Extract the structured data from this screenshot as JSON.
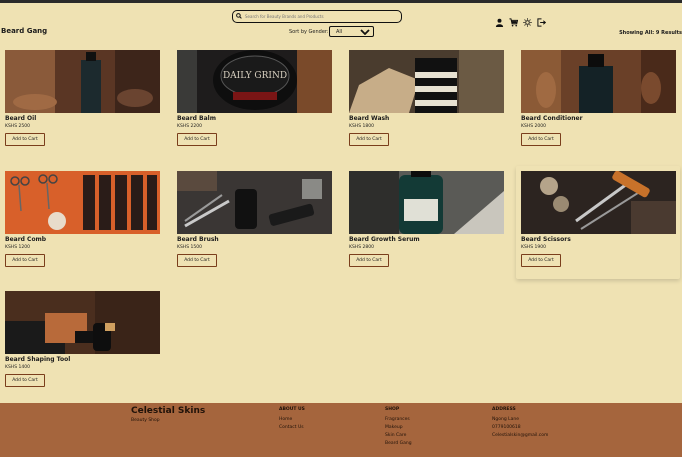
{
  "header": {
    "search_placeholder": "Search for Beauty Brands and Products",
    "icons": [
      "user-icon",
      "cart-icon",
      "theme-icon",
      "logout-icon"
    ]
  },
  "page": {
    "title": "Beard Gang",
    "sort_label": "Sort by Gender:",
    "sort_value": "All",
    "showing": "Showing All: 9 Results"
  },
  "products": [
    {
      "name": "Beard Oil",
      "price": "KSHS 2500",
      "button": "Add to Cart"
    },
    {
      "name": "Beard Balm",
      "price": "KSHS 2200",
      "button": "Add to Cart"
    },
    {
      "name": "Beard Wash",
      "price": "KSHS 1800",
      "button": "Add to Cart"
    },
    {
      "name": "Beard Conditioner",
      "price": "KSHS 2000",
      "button": "Add to Cart"
    },
    {
      "name": "Beard Comb",
      "price": "KSHS 1200",
      "button": "Add to Cart"
    },
    {
      "name": "Beard Brush",
      "price": "KSHS 1500",
      "button": "Add to Cart"
    },
    {
      "name": "Beard Growth Serum",
      "price": "KSHS 2800",
      "button": "Add to Cart"
    },
    {
      "name": "Beard Scissors",
      "price": "KSHS 1900",
      "button": "Add to Cart"
    },
    {
      "name": "Beard Shaping Tool",
      "price": "KSHS 1400",
      "button": "Add to Cart"
    }
  ],
  "footer": {
    "brand": "Celestial Skins",
    "tagline": "Beauty Shop",
    "about": {
      "heading": "ABOUT US",
      "items": [
        "Home",
        "Contact Us"
      ]
    },
    "shop": {
      "heading": "SHOP",
      "items": [
        "Fragrances",
        "Makeup",
        "Skin Care",
        "Beard Gang"
      ]
    },
    "address": {
      "heading": "ADDRESS",
      "items": [
        "Ngong Lane",
        "0779100618",
        "Celestialskin@gmail.com"
      ]
    }
  },
  "colors": {
    "background": "#efe2b3",
    "footer": "#a5653d",
    "button_border": "#7a3e1c"
  }
}
